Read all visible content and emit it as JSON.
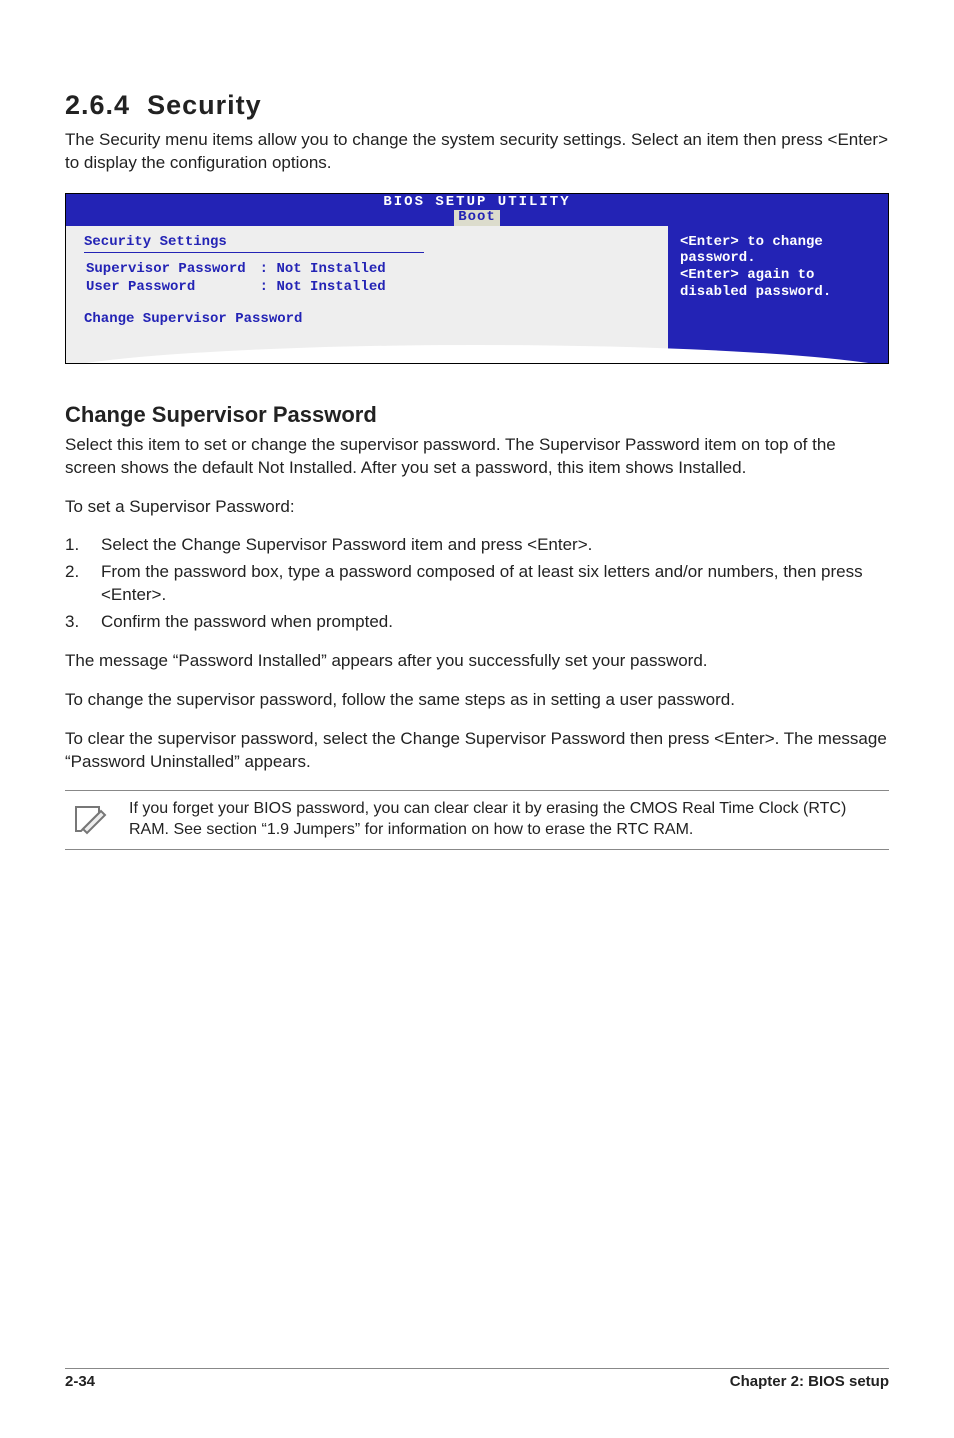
{
  "section": {
    "number": "2.6.4",
    "title": "Security"
  },
  "intro": "The Security menu items allow you to change the system security settings. Select an item then press <Enter> to display the configuration options.",
  "bios": {
    "title": "BIOS SETUP UTILITY",
    "tab": "Boot",
    "panel_heading": "Security Settings",
    "rows": [
      {
        "label": "Supervisor Password",
        "value": ": Not Installed"
      },
      {
        "label": "User Password",
        "value": ": Not Installed"
      }
    ],
    "change_item": "Change Supervisor Password",
    "help": "<Enter> to change password.\n<Enter> again to disabled password."
  },
  "subheading": "Change Supervisor Password",
  "para1": "Select this item to set or change the supervisor password. The Supervisor Password item on top of the screen shows the default Not Installed. After you set a password, this item shows Installed.",
  "para2": "To set a Supervisor Password:",
  "steps": [
    "Select the Change Supervisor Password item and press <Enter>.",
    "From the password box, type a password composed of at least six letters and/or numbers, then press <Enter>.",
    "Confirm the password when prompted."
  ],
  "para3": "The message “Password Installed” appears after you successfully set your password.",
  "para4": "To change the supervisor password, follow the same steps as in setting a user password.",
  "para5": "To clear the supervisor password, select the Change Supervisor Password then press <Enter>. The message “Password Uninstalled” appears.",
  "note": "If you forget your BIOS password, you can clear clear it by erasing the CMOS Real Time Clock (RTC) RAM. See section “1.9  Jumpers” for information on how to erase the RTC RAM.",
  "footer": {
    "left": "2-34",
    "right": "Chapter 2: BIOS setup"
  }
}
